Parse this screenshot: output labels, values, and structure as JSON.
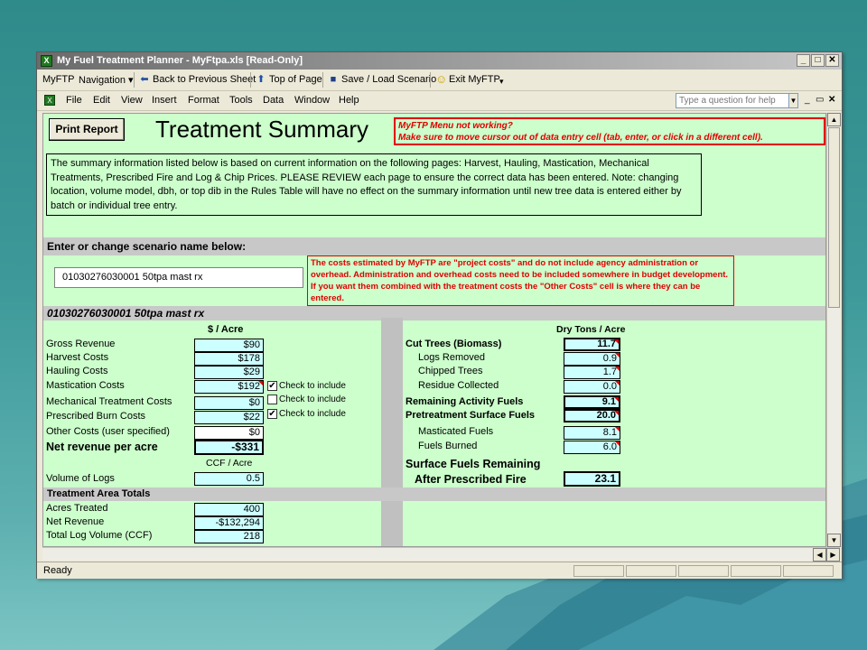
{
  "window": {
    "title": "My Fuel Treatment Planner - MyFtpa.xls  [Read-Only]",
    "controls": {
      "minimize": "_",
      "maximize": "□",
      "close": "✕"
    }
  },
  "toolbar": {
    "myftp": "MyFTP",
    "navigation": "Navigation ▾",
    "back": "Back to Previous Sheet",
    "top": "Top of Page",
    "save_load": "Save / Load Scenario",
    "exit": "Exit MyFTP"
  },
  "menu": {
    "items": [
      "File",
      "Edit",
      "View",
      "Insert",
      "Format",
      "Tools",
      "Data",
      "Window",
      "Help"
    ],
    "help_placeholder": "Type a question for help"
  },
  "sheet": {
    "print_button": "Print Report",
    "title": "Treatment Summary",
    "warning_line1": "MyFTP Menu not working?",
    "warning_line2": "Make sure to move cursor out of data entry cell (tab, enter, or click in a different cell).",
    "info_text": "The summary information listed below is based on current information on the following pages:  Harvest, Hauling, Mastication, Mechanical Treatments, Prescribed Fire and Log & Chip Prices.  PLEASE REVIEW each page to ensure the correct data has been entered.  Note: changing location, volume model, dbh, or top dib in the Rules Table will have no effect on the summary information until new tree data is entered either by batch or individual tree entry.",
    "scenario_header": "Enter or change scenario name below:",
    "scenario_name": "01030276030001 50tpa mast rx",
    "cost_note": "The costs estimated by MyFTP are \"project costs\" and do not include agency administration or overhead.  Administration and overhead costs need to be included somewhere in budget development.  If you want them combined with the treatment costs the \"Other Costs\" cell is where they can be entered.",
    "scenario_bar": "01030276030001 50tpa mast rx"
  },
  "costs": {
    "header": "$ / Acre",
    "rows": [
      {
        "label": "Gross Revenue",
        "value": "$90"
      },
      {
        "label": "Harvest Costs",
        "value": "$178"
      },
      {
        "label": "Hauling Costs",
        "value": "$29"
      },
      {
        "label": "Mastication Costs",
        "value": "$192",
        "check": "Check to include",
        "checked": "✔"
      },
      {
        "label": "Mechanical Treatment Costs",
        "value": "$0",
        "check": "Check to include",
        "checked": ""
      },
      {
        "label": "Prescribed Burn Costs",
        "value": "$22",
        "check": "Check to include",
        "checked": "✔"
      },
      {
        "label": "Other Costs (user specified)",
        "value": "$0"
      }
    ],
    "net_label": "Net revenue per acre",
    "net_value": "-$331",
    "ccf_header": "CCF / Acre",
    "volume_label": "Volume of Logs",
    "volume_value": "0.5"
  },
  "totals": {
    "header": "Treatment Area Totals",
    "rows": [
      {
        "label": "Acres Treated",
        "value": "400"
      },
      {
        "label": "Net Revenue",
        "value": "-$132,294"
      },
      {
        "label": "Total Log Volume (CCF)",
        "value": "218"
      }
    ]
  },
  "fuels": {
    "header": "Dry Tons / Acre",
    "cut_trees": {
      "label": "Cut Trees (Biomass)",
      "value": "11.7"
    },
    "logs_removed": {
      "label": "Logs Removed",
      "value": "0.9"
    },
    "chipped_trees": {
      "label": "Chipped Trees",
      "value": "1.7"
    },
    "residue": {
      "label": "Residue Collected",
      "value": "0.0"
    },
    "remaining_activity": {
      "label": "Remaining Activity Fuels",
      "value": "9.1"
    },
    "pretreatment": {
      "label": "Pretreatment Surface Fuels",
      "value": "20.0"
    },
    "masticated": {
      "label": "Masticated Fuels",
      "value": "8.1"
    },
    "burned": {
      "label": "Fuels Burned",
      "value": "6.0"
    },
    "remaining_label1": "Surface Fuels Remaining",
    "remaining_label2": "After Prescribed Fire",
    "remaining_value": "23.1"
  },
  "status": {
    "text": "Ready"
  }
}
